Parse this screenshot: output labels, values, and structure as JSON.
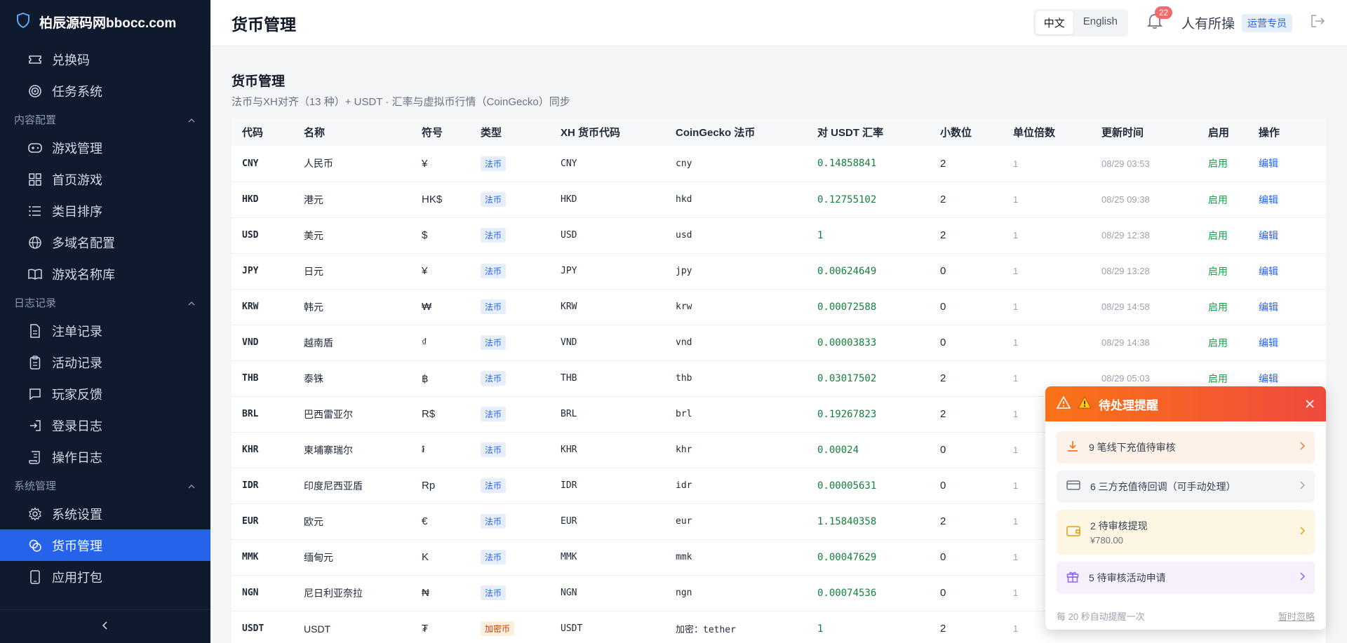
{
  "sidebar": {
    "brand": "柏辰源码网bbocc.com",
    "items_top": [
      {
        "label": "兑换码",
        "icon": "ticket-icon"
      },
      {
        "label": "任务系统",
        "icon": "target-icon"
      }
    ],
    "groups": [
      {
        "label": "内容配置",
        "items": [
          {
            "label": "游戏管理",
            "icon": "gamepad-icon"
          },
          {
            "label": "首页游戏",
            "icon": "grid-icon"
          },
          {
            "label": "类目排序",
            "icon": "list-icon"
          },
          {
            "label": "多域名配置",
            "icon": "globe-icon"
          },
          {
            "label": "游戏名称库",
            "icon": "book-icon"
          }
        ]
      },
      {
        "label": "日志记录",
        "items": [
          {
            "label": "注单记录",
            "icon": "document-icon"
          },
          {
            "label": "活动记录",
            "icon": "clipboard-icon"
          },
          {
            "label": "玩家反馈",
            "icon": "message-icon"
          },
          {
            "label": "登录日志",
            "icon": "login-icon"
          },
          {
            "label": "操作日志",
            "icon": "scroll-icon"
          }
        ]
      },
      {
        "label": "系统管理",
        "items": [
          {
            "label": "系统设置",
            "icon": "gear-icon"
          },
          {
            "label": "货币管理",
            "icon": "coins-icon",
            "active": true
          },
          {
            "label": "应用打包",
            "icon": "phone-icon"
          }
        ]
      }
    ]
  },
  "header": {
    "title": "货币管理",
    "lang_zh": "中文",
    "lang_en": "English",
    "notification_count": "22",
    "user_name": "人有所操",
    "role": "运营专员"
  },
  "main": {
    "title": "货币管理",
    "subtitle": "法币与XH对齐（13 种）+ USDT · 汇率与虚拟币行情（CoinGecko）同步"
  },
  "table": {
    "columns": [
      "代码",
      "名称",
      "符号",
      "类型",
      "XH 货币代码",
      "CoinGecko 法币",
      "对 USDT 汇率",
      "小数位",
      "单位倍数",
      "更新时间",
      "启用",
      "操作"
    ],
    "rows": [
      {
        "code": "CNY",
        "name": "人民币",
        "symbol": "¥",
        "type": "法币",
        "xh": "CNY",
        "cg": "cny",
        "rate": "0.14858841",
        "dec": "2",
        "mult": "1",
        "time": "08/29 03:53",
        "enabled": "启用",
        "action": "编辑"
      },
      {
        "code": "HKD",
        "name": "港元",
        "symbol": "HK$",
        "type": "法币",
        "xh": "HKD",
        "cg": "hkd",
        "rate": "0.12755102",
        "dec": "2",
        "mult": "1",
        "time": "08/25 09:38",
        "enabled": "启用",
        "action": "编辑"
      },
      {
        "code": "USD",
        "name": "美元",
        "symbol": "$",
        "type": "法币",
        "xh": "USD",
        "cg": "usd",
        "rate": "1",
        "dec": "2",
        "mult": "1",
        "time": "08/29 12:38",
        "enabled": "启用",
        "action": "编辑"
      },
      {
        "code": "JPY",
        "name": "日元",
        "symbol": "¥",
        "type": "法币",
        "xh": "JPY",
        "cg": "jpy",
        "rate": "0.00624649",
        "dec": "0",
        "mult": "1",
        "time": "08/29 13:28",
        "enabled": "启用",
        "action": "编辑"
      },
      {
        "code": "KRW",
        "name": "韩元",
        "symbol": "₩",
        "type": "法币",
        "xh": "KRW",
        "cg": "krw",
        "rate": "0.00072588",
        "dec": "0",
        "mult": "1",
        "time": "08/29 14:58",
        "enabled": "启用",
        "action": "编辑"
      },
      {
        "code": "VND",
        "name": "越南盾",
        "symbol": "₫",
        "type": "法币",
        "xh": "VND",
        "cg": "vnd",
        "rate": "0.00003833",
        "dec": "0",
        "mult": "1",
        "time": "08/29 14:38",
        "enabled": "启用",
        "action": "编辑"
      },
      {
        "code": "THB",
        "name": "泰铢",
        "symbol": "฿",
        "type": "法币",
        "xh": "THB",
        "cg": "thb",
        "rate": "0.03017502",
        "dec": "2",
        "mult": "1",
        "time": "08/29 05:03",
        "enabled": "启用",
        "action": "编辑"
      },
      {
        "code": "BRL",
        "name": "巴西雷亚尔",
        "symbol": "R$",
        "type": "法币",
        "xh": "BRL",
        "cg": "brl",
        "rate": "0.19267823",
        "dec": "2",
        "mult": "1",
        "time": "",
        "enabled": "",
        "action": ""
      },
      {
        "code": "KHR",
        "name": "柬埔寨瑞尔",
        "symbol": "៛",
        "type": "法币",
        "xh": "KHR",
        "cg": "khr",
        "rate": "0.00024",
        "dec": "0",
        "mult": "1",
        "time": "",
        "enabled": "",
        "action": ""
      },
      {
        "code": "IDR",
        "name": "印度尼西亚盾",
        "symbol": "Rp",
        "type": "法币",
        "xh": "IDR",
        "cg": "idr",
        "rate": "0.00005631",
        "dec": "0",
        "mult": "1",
        "time": "",
        "enabled": "",
        "action": ""
      },
      {
        "code": "EUR",
        "name": "欧元",
        "symbol": "€",
        "type": "法币",
        "xh": "EUR",
        "cg": "eur",
        "rate": "1.15840358",
        "dec": "2",
        "mult": "1",
        "time": "",
        "enabled": "",
        "action": ""
      },
      {
        "code": "MMK",
        "name": "缅甸元",
        "symbol": "K",
        "type": "法币",
        "xh": "MMK",
        "cg": "mmk",
        "rate": "0.00047629",
        "dec": "0",
        "mult": "1",
        "time": "",
        "enabled": "",
        "action": ""
      },
      {
        "code": "NGN",
        "name": "尼日利亚奈拉",
        "symbol": "₦",
        "type": "法币",
        "xh": "NGN",
        "cg": "ngn",
        "rate": "0.00074536",
        "dec": "0",
        "mult": "1",
        "time": "",
        "enabled": "",
        "action": ""
      },
      {
        "code": "USDT",
        "name": "USDT",
        "symbol": "₮",
        "type": "加密币",
        "xh": "USDT",
        "cg": "加密：tether",
        "rate": "1",
        "dec": "2",
        "mult": "1",
        "time": "",
        "enabled": "",
        "action": ""
      }
    ]
  },
  "popup": {
    "title": "待处理提醒",
    "items": [
      {
        "text": "9 笔线下充值待审核",
        "icon": "download-icon"
      },
      {
        "text": "6 三方充值待回调（可手动处理）",
        "icon": "card-icon"
      },
      {
        "text": "2 待审核提现",
        "sub": "¥780.00",
        "icon": "wallet-icon"
      },
      {
        "text": "5 待审核活动申请",
        "icon": "gift-icon"
      }
    ],
    "footer_note": "每 20 秒自动提醒一次",
    "ignore": "暂时忽略"
  },
  "colors": {
    "sidebar_bg": "#0f1a2e",
    "accent": "#2563eb",
    "rate_green": "#15803d",
    "popup_orange": "#f97316"
  }
}
